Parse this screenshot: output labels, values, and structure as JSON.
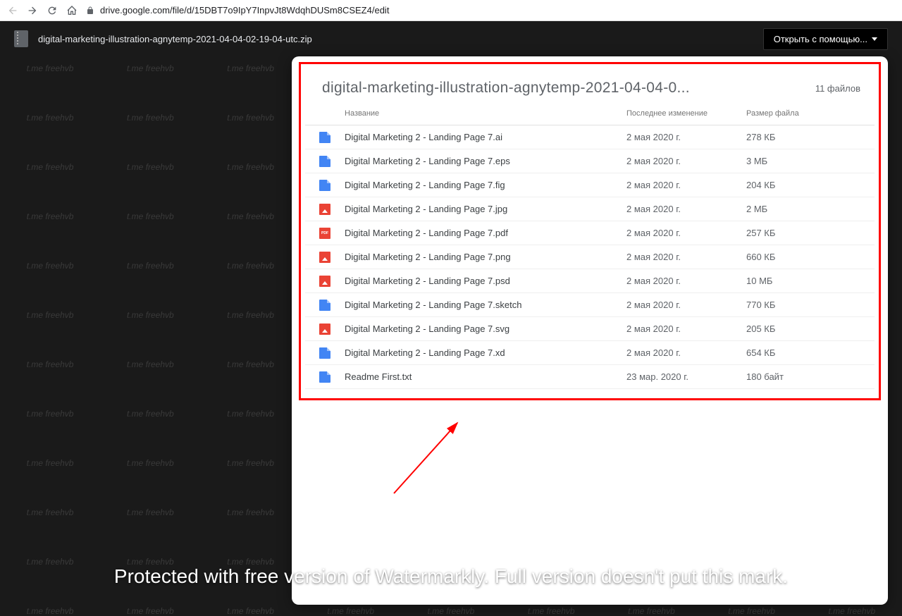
{
  "browser": {
    "url": "drive.google.com/file/d/15DBT7o9IpY7InpvJt8WdqhDUSm8CSEZ4/edit"
  },
  "drive": {
    "filename": "digital-marketing-illustration-agnytemp-2021-04-04-02-19-04-utc.zip",
    "open_with": "Открыть с помощью..."
  },
  "archive": {
    "title": "digital-marketing-illustration-agnytemp-2021-04-04-0...",
    "count": "11 файлов",
    "columns": {
      "name": "Название",
      "modified": "Последнее изменение",
      "size": "Размер файла"
    },
    "files": [
      {
        "name": "Digital Marketing 2 - Landing Page 7.ai",
        "modified": "2 мая 2020 г.",
        "size": "278 КБ",
        "icon": "blue"
      },
      {
        "name": "Digital Marketing 2 - Landing Page 7.eps",
        "modified": "2 мая 2020 г.",
        "size": "3 МБ",
        "icon": "blue"
      },
      {
        "name": "Digital Marketing 2 - Landing Page 7.fig",
        "modified": "2 мая 2020 г.",
        "size": "204 КБ",
        "icon": "blue"
      },
      {
        "name": "Digital Marketing 2 - Landing Page 7.jpg",
        "modified": "2 мая 2020 г.",
        "size": "2 МБ",
        "icon": "img"
      },
      {
        "name": "Digital Marketing 2 - Landing Page 7.pdf",
        "modified": "2 мая 2020 г.",
        "size": "257 КБ",
        "icon": "pdf"
      },
      {
        "name": "Digital Marketing 2 - Landing Page 7.png",
        "modified": "2 мая 2020 г.",
        "size": "660 КБ",
        "icon": "img"
      },
      {
        "name": "Digital Marketing 2 - Landing Page 7.psd",
        "modified": "2 мая 2020 г.",
        "size": "10 МБ",
        "icon": "img"
      },
      {
        "name": "Digital Marketing 2 - Landing Page 7.sketch",
        "modified": "2 мая 2020 г.",
        "size": "770 КБ",
        "icon": "blue"
      },
      {
        "name": "Digital Marketing 2 - Landing Page 7.svg",
        "modified": "2 мая 2020 г.",
        "size": "205 КБ",
        "icon": "img"
      },
      {
        "name": "Digital Marketing 2 - Landing Page 7.xd",
        "modified": "2 мая 2020 г.",
        "size": "654 КБ",
        "icon": "blue"
      },
      {
        "name": "Readme First.txt",
        "modified": "23 мар. 2020 г.",
        "size": "180 байт",
        "icon": "blue"
      }
    ]
  },
  "watermark": {
    "repeat": "t.me freehvb",
    "bottom": "Protected with free version of Watermarkly. Full version doesn't put this mark."
  }
}
